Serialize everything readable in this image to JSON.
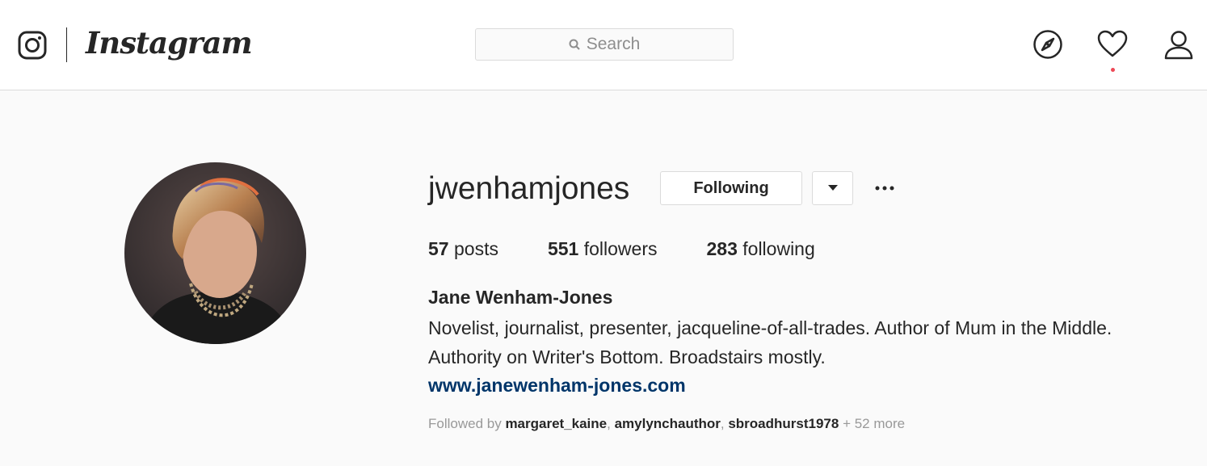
{
  "header": {
    "wordmark": "Instagram",
    "search_placeholder": "Search"
  },
  "profile": {
    "username": "jwenhamjones",
    "following_button": "Following",
    "stats": {
      "posts_count": "57",
      "posts_label": " posts",
      "followers_count": "551",
      "followers_label": " followers",
      "following_count": "283",
      "following_label": " following"
    },
    "full_name": "Jane Wenham-Jones",
    "bio": "Novelist, journalist, presenter, jacqueline-of-all-trades. Author of Mum in the Middle. Authority on Writer's Bottom. Broadstairs mostly.",
    "website": "www.janewenham-jones.com",
    "followed_by": {
      "prefix": "Followed by ",
      "users": [
        "margaret_kaine",
        "amylynchauthor",
        "sbroadhurst1978"
      ],
      "sep": ", ",
      "suffix": " + 52 more"
    }
  },
  "colors": {
    "link": "#003569",
    "notification_dot": "#ed4956",
    "border": "#dbdbdb"
  }
}
